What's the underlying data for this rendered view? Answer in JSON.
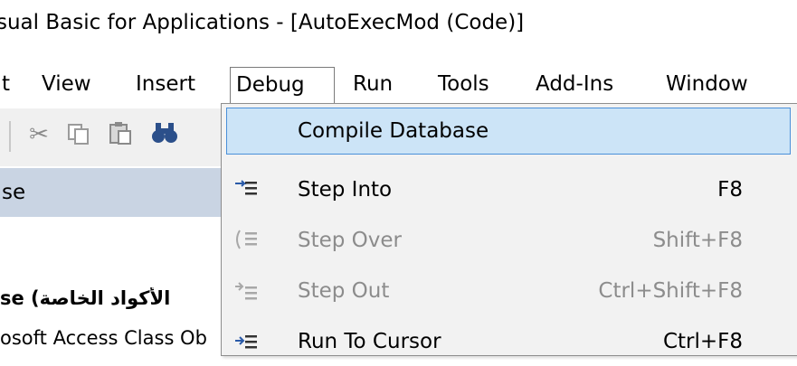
{
  "window": {
    "title": "sual Basic for Applications - [AutoExecMod (Code)]"
  },
  "menubar": {
    "items": [
      {
        "label": "t"
      },
      {
        "label": "View"
      },
      {
        "label": "Insert"
      },
      {
        "label": "Debug"
      },
      {
        "label": "Run"
      },
      {
        "label": "Tools"
      },
      {
        "label": "Add-Ins"
      },
      {
        "label": "Window"
      }
    ]
  },
  "toolbar": {
    "icons": [
      "cut-icon",
      "copy-icon",
      "paste-icon",
      "find-icon"
    ]
  },
  "project_pane": {
    "selected_row": "se",
    "row1": "se (الأكواد الخاصة",
    "row2": "osoft Access Class Ob"
  },
  "debug_menu": {
    "items": [
      {
        "label": "Compile Database",
        "shortcut": "",
        "icon": "",
        "enabled": true,
        "highlighted": true
      },
      {
        "label": "Step Into",
        "shortcut": "F8",
        "icon": "step-into-icon",
        "enabled": true
      },
      {
        "label": "Step Over",
        "shortcut": "Shift+F8",
        "icon": "step-over-icon",
        "enabled": false
      },
      {
        "label": "Step Out",
        "shortcut": "Ctrl+Shift+F8",
        "icon": "step-out-icon",
        "enabled": false
      },
      {
        "label": "Run To Cursor",
        "shortcut": "Ctrl+F8",
        "icon": "run-to-cursor-icon",
        "enabled": true
      }
    ]
  },
  "colors": {
    "highlight_bg": "#cce4f7",
    "highlight_border": "#4a90d9",
    "selected_row_bg": "#c9d4e3",
    "disabled_text": "#8c8c8c"
  }
}
